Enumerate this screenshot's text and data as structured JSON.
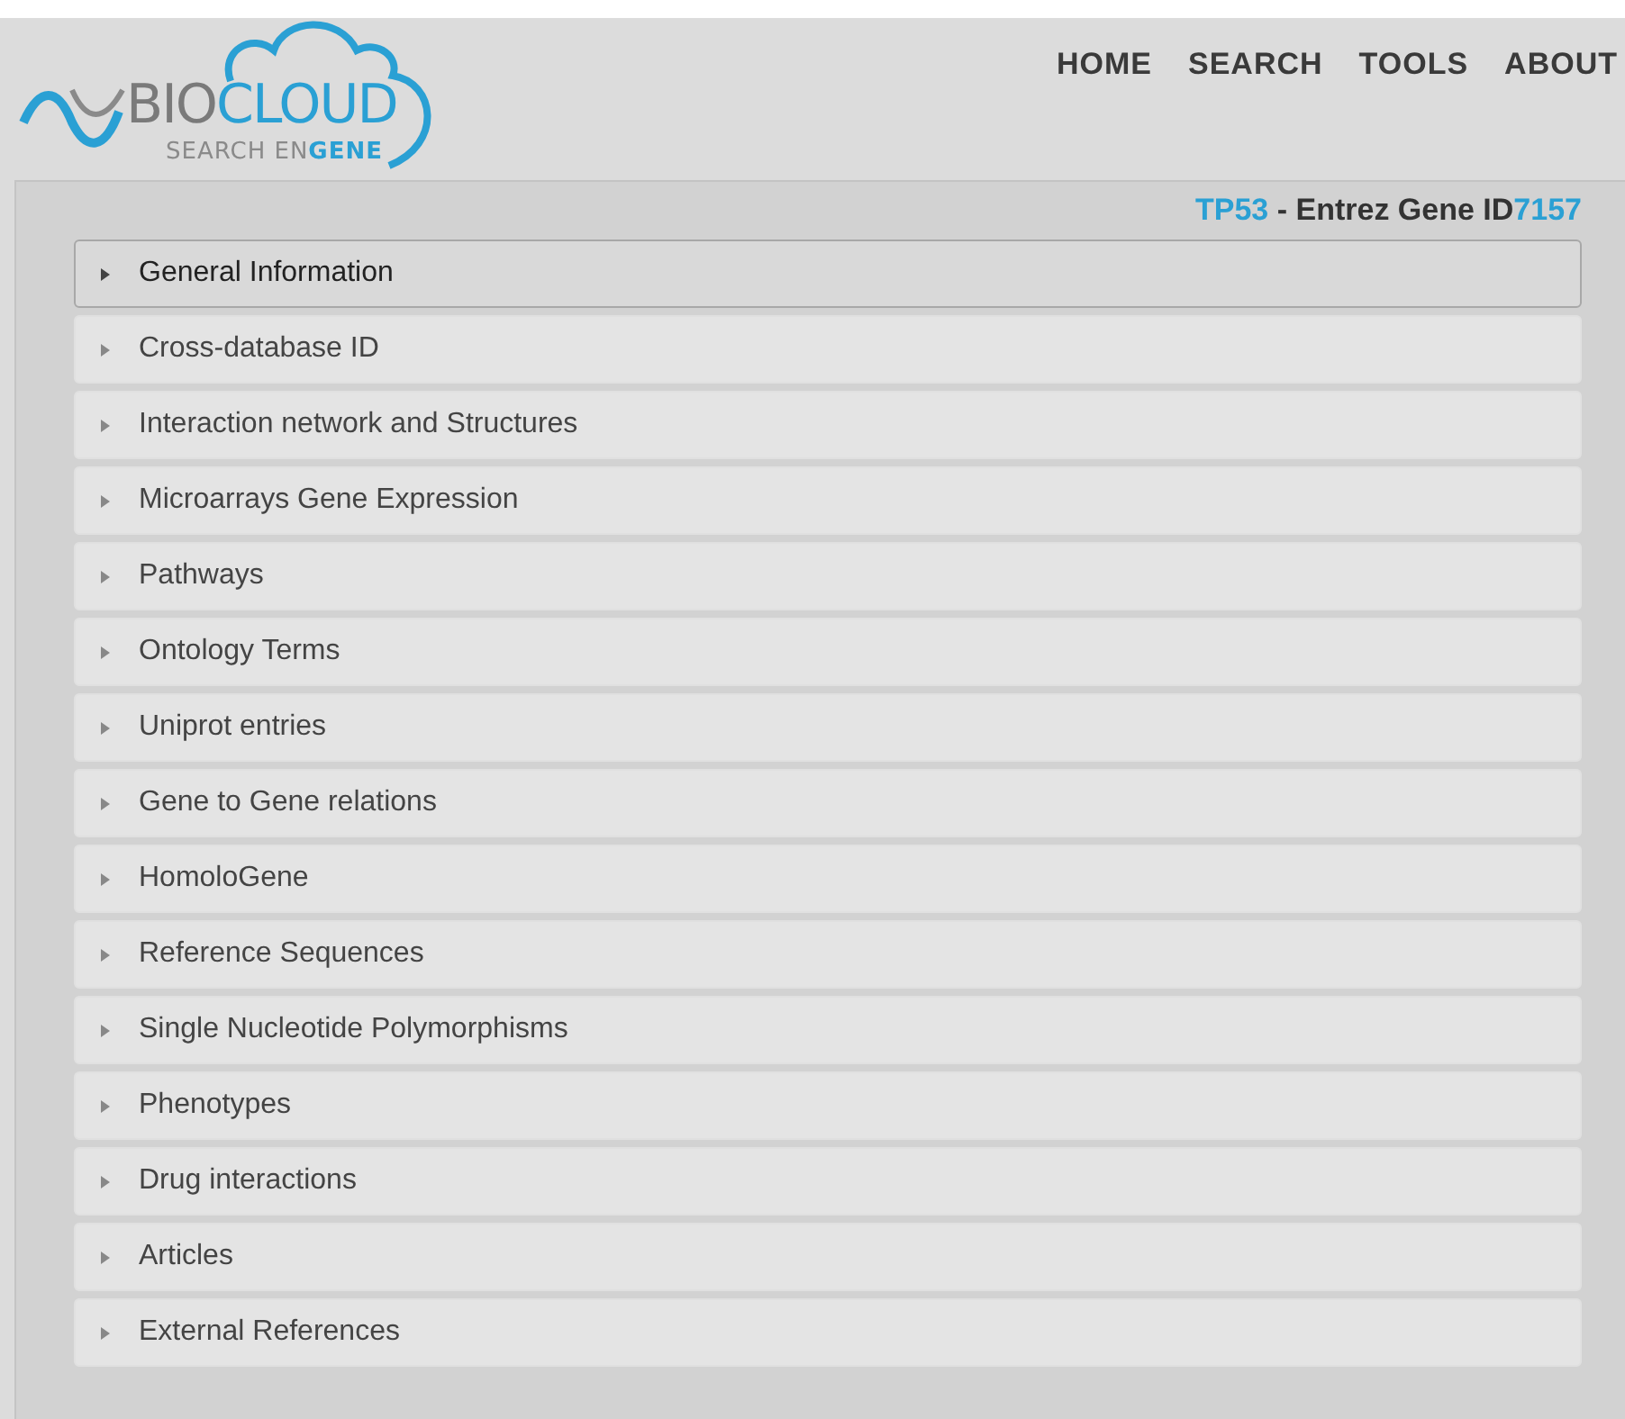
{
  "logo": {
    "title": [
      {
        "text": "BIO",
        "kind": "plain"
      },
      {
        "text": "CLOUD",
        "kind": "accent"
      }
    ],
    "subtitle": [
      {
        "text": "SEARCH EN",
        "kind": "plain"
      },
      {
        "text": "GENE",
        "kind": "accent"
      }
    ]
  },
  "nav": [
    "HOME",
    "SEARCH",
    "TOOLS",
    "ABOUT"
  ],
  "heading": {
    "gene": "TP53",
    "label": "- Entrez Gene ID",
    "id": "7157"
  },
  "sections": [
    {
      "label": "General Information",
      "selected": true
    },
    {
      "label": "Cross-database ID",
      "selected": false
    },
    {
      "label": "Interaction network and Structures",
      "selected": false
    },
    {
      "label": "Microarrays Gene Expression",
      "selected": false
    },
    {
      "label": "Pathways",
      "selected": false
    },
    {
      "label": "Ontology Terms",
      "selected": false
    },
    {
      "label": "Uniprot entries",
      "selected": false
    },
    {
      "label": "Gene to Gene relations",
      "selected": false
    },
    {
      "label": "HomoloGene",
      "selected": false
    },
    {
      "label": "Reference Sequences",
      "selected": false
    },
    {
      "label": "Single Nucleotide Polymorphisms",
      "selected": false
    },
    {
      "label": "Phenotypes",
      "selected": false
    },
    {
      "label": "Drug interactions",
      "selected": false
    },
    {
      "label": "Articles",
      "selected": false
    },
    {
      "label": "External References",
      "selected": false
    }
  ]
}
